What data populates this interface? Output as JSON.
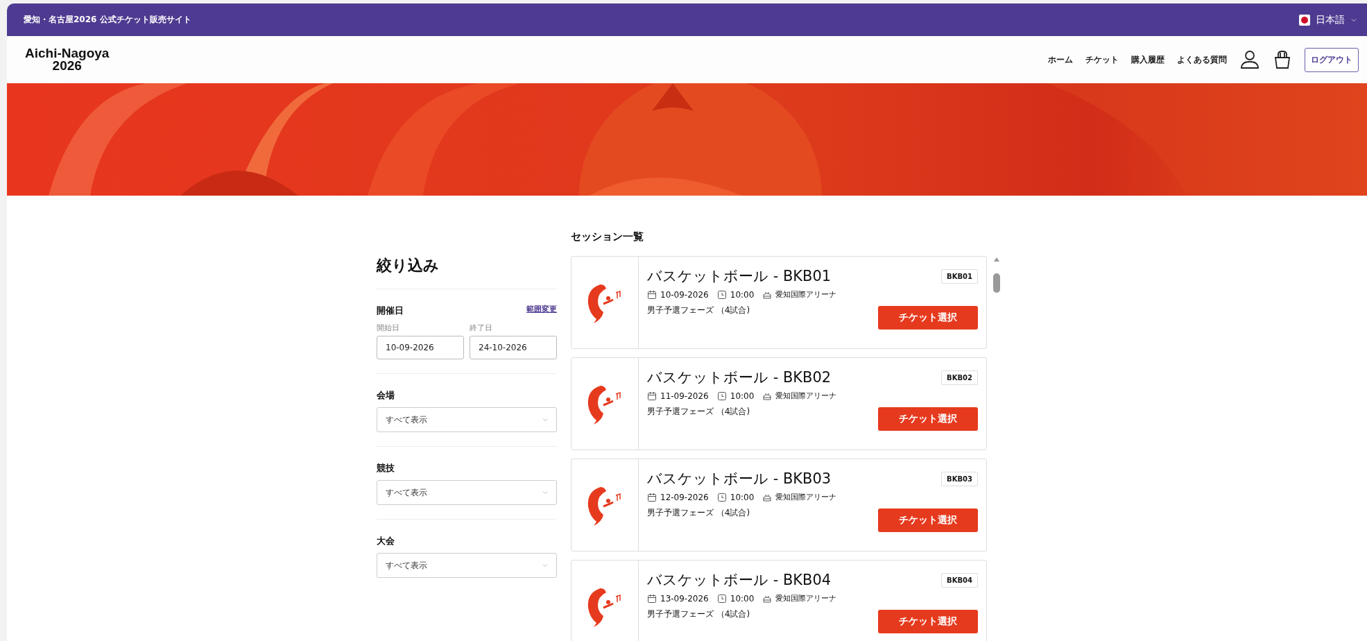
{
  "top_bar": {
    "site_title": "愛知・名古屋2026 公式チケット販売サイト",
    "language": "日本語"
  },
  "header": {
    "logo_line1": "Aichi-Nagoya",
    "logo_line2": "2026",
    "nav": [
      "ホーム",
      "チケット",
      "購入履歴",
      "よくある質問"
    ],
    "logout": "ログアウト"
  },
  "filter": {
    "title": "絞り込み",
    "date": {
      "label": "開催日",
      "link": "範囲変更",
      "start_label": "開始日",
      "start_value": "10-09-2026",
      "end_label": "終了日",
      "end_value": "24-10-2026"
    },
    "selects": [
      {
        "label": "会場",
        "value": "すべて表示"
      },
      {
        "label": "競技",
        "value": "すべて表示"
      },
      {
        "label": "大会",
        "value": "すべて表示"
      }
    ]
  },
  "sessions": {
    "title": "セッション一覧",
    "items": [
      {
        "name": "バスケットボール - BKB01",
        "code": "BKB01",
        "date": "10-09-2026",
        "time": "10:00",
        "venue": "愛知国際アリーナ",
        "description": "男子予選フェーズ （4試合)",
        "button": "チケット選択"
      },
      {
        "name": "バスケットボール - BKB02",
        "code": "BKB02",
        "date": "11-09-2026",
        "time": "10:00",
        "venue": "愛知国際アリーナ",
        "description": "男子予選フェーズ （4試合)",
        "button": "チケット選択"
      },
      {
        "name": "バスケットボール - BKB03",
        "code": "BKB03",
        "date": "12-09-2026",
        "time": "10:00",
        "venue": "愛知国際アリーナ",
        "description": "男子予選フェーズ （4試合)",
        "button": "チケット選択"
      },
      {
        "name": "バスケットボール - BKB04",
        "code": "BKB04",
        "date": "13-09-2026",
        "time": "10:00",
        "venue": "愛知国際アリーナ",
        "description": "男子予選フェーズ （4試合)",
        "button": "チケット選択"
      }
    ]
  }
}
